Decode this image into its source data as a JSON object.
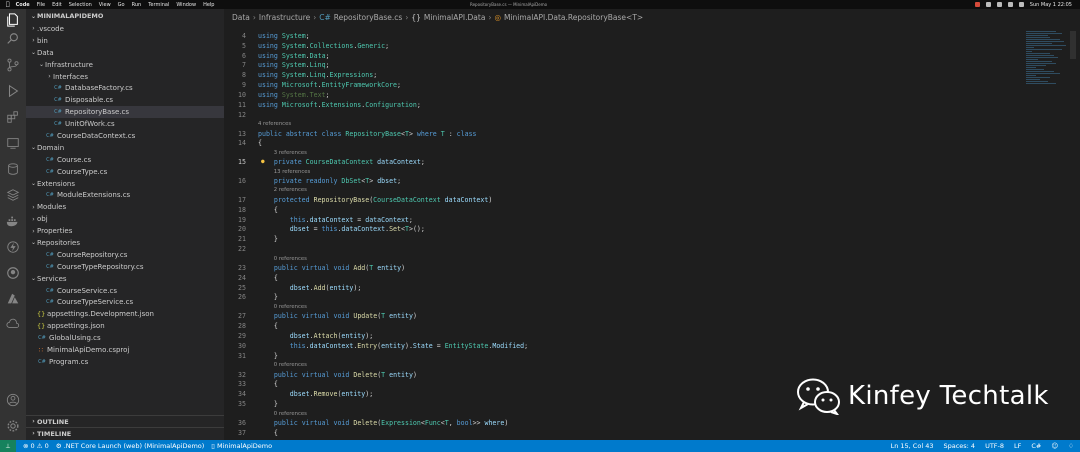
{
  "menubar": {
    "app": "Code",
    "items": [
      "File",
      "Edit",
      "Selection",
      "View",
      "Go",
      "Run",
      "Terminal",
      "Window",
      "Help"
    ],
    "window_title": "RepositoryBase.cs — MinimalApiDemo",
    "clock": "Sun May 1 22:05"
  },
  "sidebar": {
    "root": "MINIMALAPIDEMO",
    "tree": [
      {
        "label": ".vscode",
        "type": "folder",
        "open": false,
        "depth": 1
      },
      {
        "label": "bin",
        "type": "folder",
        "open": false,
        "depth": 1
      },
      {
        "label": "Data",
        "type": "folder",
        "open": true,
        "depth": 1
      },
      {
        "label": "Infrastructure",
        "type": "folder",
        "open": true,
        "depth": 2
      },
      {
        "label": "Interfaces",
        "type": "folder",
        "open": false,
        "depth": 3
      },
      {
        "label": "DatabaseFactory.cs",
        "type": "cs",
        "depth": 3
      },
      {
        "label": "Disposable.cs",
        "type": "cs",
        "depth": 3
      },
      {
        "label": "RepositoryBase.cs",
        "type": "cs",
        "depth": 3,
        "selected": true
      },
      {
        "label": "UnitOfWork.cs",
        "type": "cs",
        "depth": 3
      },
      {
        "label": "CourseDataContext.cs",
        "type": "cs",
        "depth": 2
      },
      {
        "label": "Domain",
        "type": "folder",
        "open": true,
        "depth": 1
      },
      {
        "label": "Course.cs",
        "type": "cs",
        "depth": 2
      },
      {
        "label": "CourseType.cs",
        "type": "cs",
        "depth": 2
      },
      {
        "label": "Extensions",
        "type": "folder",
        "open": true,
        "depth": 1
      },
      {
        "label": "ModuleExtensions.cs",
        "type": "cs",
        "depth": 2
      },
      {
        "label": "Modules",
        "type": "folder",
        "open": false,
        "depth": 1
      },
      {
        "label": "obj",
        "type": "folder",
        "open": false,
        "depth": 1
      },
      {
        "label": "Properties",
        "type": "folder",
        "open": false,
        "depth": 1
      },
      {
        "label": "Repositories",
        "type": "folder",
        "open": true,
        "depth": 1
      },
      {
        "label": "CourseRepository.cs",
        "type": "cs",
        "depth": 2
      },
      {
        "label": "CourseTypeRepository.cs",
        "type": "cs",
        "depth": 2
      },
      {
        "label": "Services",
        "type": "folder",
        "open": true,
        "depth": 1
      },
      {
        "label": "CourseService.cs",
        "type": "cs",
        "depth": 2
      },
      {
        "label": "CourseTypeService.cs",
        "type": "cs",
        "depth": 2
      },
      {
        "label": "appsettings.Development.json",
        "type": "json",
        "depth": 1
      },
      {
        "label": "appsettings.json",
        "type": "json",
        "depth": 1
      },
      {
        "label": "GlobalUsing.cs",
        "type": "cs",
        "depth": 1
      },
      {
        "label": "MinimalApiDemo.csproj",
        "type": "rss",
        "depth": 1
      },
      {
        "label": "Program.cs",
        "type": "cs",
        "depth": 1
      }
    ],
    "outline": "OUTLINE",
    "timeline": "TIMELINE"
  },
  "breadcrumb": {
    "parts": [
      "Data",
      "Infrastructure",
      "RepositoryBase.cs",
      "MinimalAPI.Data",
      "MinimalAPI.Data.RepositoryBase<T>"
    ]
  },
  "code": [
    {
      "n": "4",
      "html": "<span class='k'>using</span> <span class='ns'>System</span>;"
    },
    {
      "n": "5",
      "html": "<span class='k'>using</span> <span class='ns'>System</span>.<span class='ns'>Collections</span>.<span class='ns'>Generic</span>;"
    },
    {
      "n": "6",
      "html": "<span class='k'>using</span> <span class='ns'>System</span>.<span class='ns'>Data</span>;"
    },
    {
      "n": "7",
      "html": "<span class='k'>using</span> <span class='ns'>System</span>.<span class='ns'>Linq</span>;"
    },
    {
      "n": "8",
      "html": "<span class='k'>using</span> <span class='ns'>System</span>.<span class='ns'>Linq</span>.<span class='ns'>Expressions</span>;"
    },
    {
      "n": "9",
      "html": "<span class='k'>using</span> <span class='ns'>Microsoft</span>.<span class='ns'>EntityFrameworkCore</span>;"
    },
    {
      "n": "10",
      "html": "<span class='k'>using</span> <span class='dim'>System.Text</span>;"
    },
    {
      "n": "11",
      "html": "<span class='k'>using</span> <span class='ns'>Microsoft</span>.<span class='ns'>Extensions</span>.<span class='ns'>Configuration</span>;"
    },
    {
      "n": "12",
      "html": ""
    },
    {
      "lens": "4 references"
    },
    {
      "n": "13",
      "html": "<span class='k'>public</span> <span class='k'>abstract</span> <span class='k'>class</span> <span class='t'>RepositoryBase</span>&lt;<span class='t'>T</span>&gt; <span class='k'>where</span> <span class='t'>T</span> : <span class='k'>class</span>"
    },
    {
      "n": "14",
      "html": "{"
    },
    {
      "lens": "3 references",
      "indent": 1
    },
    {
      "n": "15",
      "current": true,
      "bulb": true,
      "html": "    <span class='k'>private</span> <span class='t'>CourseDataContext</span> <span class='v'>dataContext</span>;"
    },
    {
      "lens": "13 references",
      "indent": 1
    },
    {
      "n": "16",
      "html": "    <span class='k'>private</span> <span class='k'>readonly</span> <span class='t'>DbSet</span>&lt;<span class='t'>T</span>&gt; <span class='v'>dbset</span>;"
    },
    {
      "lens": "2 references",
      "indent": 1
    },
    {
      "n": "17",
      "html": "    <span class='k'>protected</span> <span class='f'>RepositoryBase</span>(<span class='t'>CourseDataContext</span> <span class='v'>dataContext</span>)"
    },
    {
      "n": "18",
      "html": "    {"
    },
    {
      "n": "19",
      "html": "        <span class='k'>this</span>.<span class='v'>dataContext</span> = <span class='v'>dataContext</span>;"
    },
    {
      "n": "20",
      "html": "        <span class='v'>dbset</span> = <span class='k'>this</span>.<span class='v'>dataContext</span>.<span class='f'>Set</span>&lt;<span class='t'>T</span>&gt;();"
    },
    {
      "n": "21",
      "html": "    }"
    },
    {
      "n": "22",
      "html": ""
    },
    {
      "lens": "0 references",
      "indent": 1
    },
    {
      "n": "23",
      "html": "    <span class='k'>public</span> <span class='k'>virtual</span> <span class='k'>void</span> <span class='f'>Add</span>(<span class='t'>T</span> <span class='v'>entity</span>)"
    },
    {
      "n": "24",
      "html": "    {"
    },
    {
      "n": "25",
      "html": "        <span class='v'>dbset</span>.<span class='f'>Add</span>(<span class='v'>entity</span>);"
    },
    {
      "n": "26",
      "html": "    }"
    },
    {
      "lens": "0 references",
      "indent": 1
    },
    {
      "n": "27",
      "html": "    <span class='k'>public</span> <span class='k'>virtual</span> <span class='k'>void</span> <span class='f'>Update</span>(<span class='t'>T</span> <span class='v'>entity</span>)"
    },
    {
      "n": "28",
      "html": "    {"
    },
    {
      "n": "29",
      "html": "        <span class='v'>dbset</span>.<span class='f'>Attach</span>(<span class='v'>entity</span>);"
    },
    {
      "n": "30",
      "html": "        <span class='k'>this</span>.<span class='v'>dataContext</span>.<span class='f'>Entry</span>(<span class='v'>entity</span>).<span class='v'>State</span> = <span class='t'>EntityState</span>.<span class='v'>Modified</span>;"
    },
    {
      "n": "31",
      "html": "    }"
    },
    {
      "lens": "0 references",
      "indent": 1
    },
    {
      "n": "32",
      "html": "    <span class='k'>public</span> <span class='k'>virtual</span> <span class='k'>void</span> <span class='f'>Delete</span>(<span class='t'>T</span> <span class='v'>entity</span>)"
    },
    {
      "n": "33",
      "html": "    {"
    },
    {
      "n": "34",
      "html": "        <span class='v'>dbset</span>.<span class='f'>Remove</span>(<span class='v'>entity</span>);"
    },
    {
      "n": "35",
      "html": "    }"
    },
    {
      "lens": "0 references",
      "indent": 1
    },
    {
      "n": "36",
      "html": "    <span class='k'>public</span> <span class='k'>virtual</span> <span class='k'>void</span> <span class='f'>Delete</span>(<span class='t'>Expression</span>&lt;<span class='t'>Func</span>&lt;<span class='t'>T</span>, <span class='k'>bool</span>&gt;&gt; <span class='v'>where</span>)"
    },
    {
      "n": "37",
      "html": "    {"
    }
  ],
  "watermark": {
    "text": "Kinfey Techtalk"
  },
  "statusbar": {
    "errors": "0",
    "warnings": "0",
    "launch": ".NET Core Launch (web) (MinimalApiDemo)",
    "project": "MinimalApiDemo",
    "position": "Ln 15, Col 43",
    "spaces": "Spaces: 4",
    "encoding": "UTF-8",
    "eol": "LF",
    "language": "C#"
  },
  "colors": {
    "accent": "#007acc",
    "sidebar": "#252526",
    "editor": "#1e1e1e",
    "activity": "#333333"
  }
}
